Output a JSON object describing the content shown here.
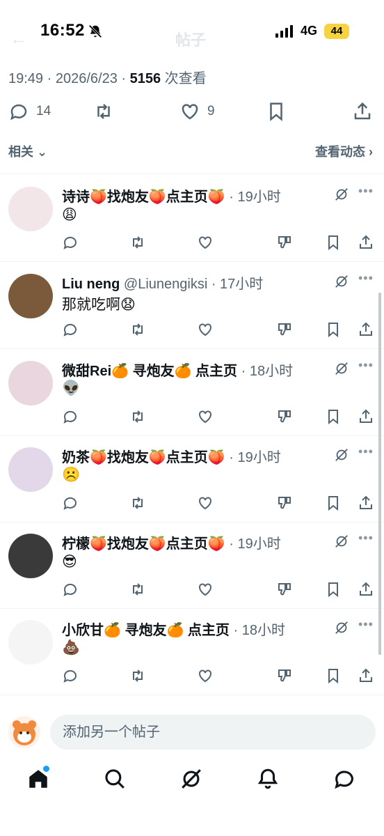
{
  "status_bar": {
    "time": "16:52",
    "network": "4G",
    "battery": "44",
    "ghost_title": "帖子"
  },
  "post": {
    "time": "19:49",
    "date": "2026/6/23",
    "views": "5156",
    "views_label": "次查看",
    "replies": "14",
    "likes": "9"
  },
  "related": {
    "label": "相关",
    "activity": "查看动态"
  },
  "replies": [
    {
      "name": "诗诗🍑找炮友🍑点主页🍑",
      "handle": "",
      "ago": "19小时",
      "text": "😩",
      "avatar_color": "#f2e6e8"
    },
    {
      "name": "Liu neng",
      "handle": "@Liunengiksi",
      "ago": "17小时",
      "text": "那就吃啊😧",
      "avatar_color": "#7a5a3a"
    },
    {
      "name": "微甜Rei🍊 寻炮友🍊 点主页",
      "handle": "",
      "ago": "18小时",
      "text": "👽",
      "avatar_color": "#e9d6de"
    },
    {
      "name": "奶茶🍑找炮友🍑点主页🍑",
      "handle": "",
      "ago": "19小时",
      "text": "☹️",
      "avatar_color": "#e3d7ea"
    },
    {
      "name": "柠檬🍑找炮友🍑点主页🍑",
      "handle": "",
      "ago": "19小时",
      "text": "😎",
      "avatar_color": "#3a3a3a"
    },
    {
      "name": "小欣甘🍊 寻炮友🍊 点主页",
      "handle": "",
      "ago": "18小时",
      "text": "💩",
      "avatar_color": "#f5f5f5"
    }
  ],
  "compose": {
    "placeholder": "添加另一个帖子"
  },
  "nav": [
    "home-icon",
    "search-icon",
    "grok-icon",
    "notifications-icon",
    "messages-icon"
  ],
  "colors": {
    "secondary_text": "#536471",
    "accent": "#1d9bf0",
    "divider": "#eff3f4"
  }
}
